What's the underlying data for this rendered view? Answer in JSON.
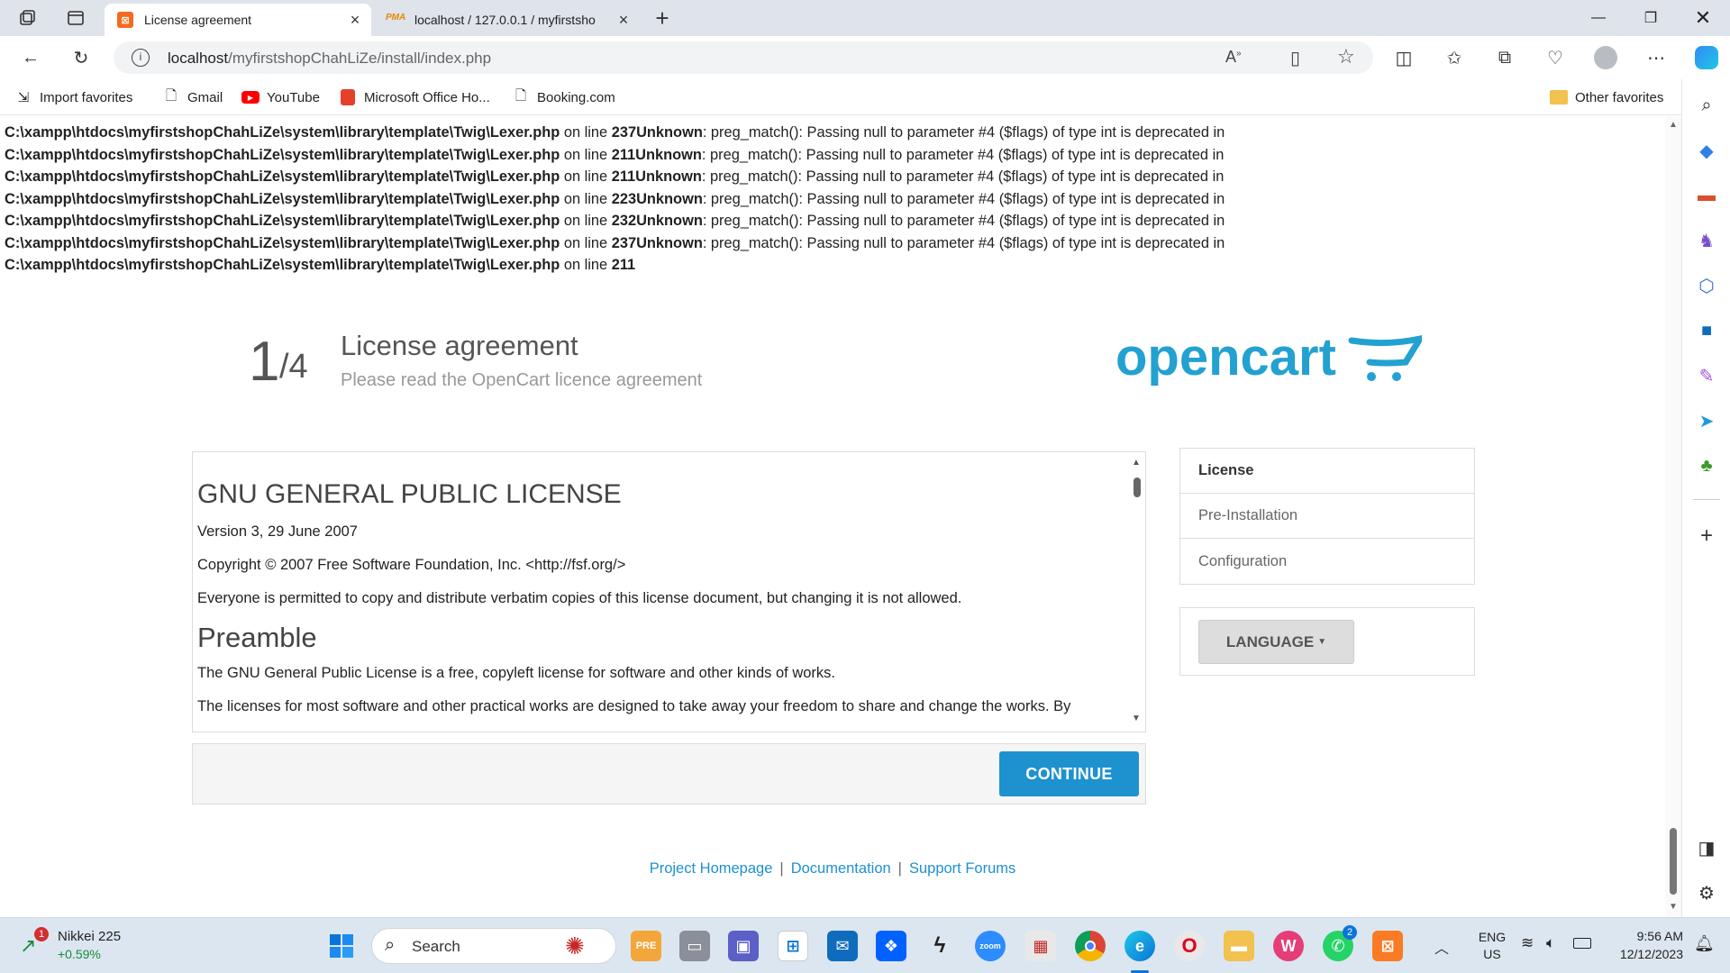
{
  "browser": {
    "tabs": [
      {
        "title": "License agreement",
        "active": true
      },
      {
        "title": "localhost / 127.0.0.1 / myfirstsho",
        "active": false
      }
    ],
    "address": {
      "host": "localhost",
      "path": "/myfirstshopChahLiZe/install/index.php"
    },
    "favorites": [
      "Import favorites",
      "Gmail",
      "YouTube",
      "Microsoft Office Ho...",
      "Booking.com"
    ],
    "other_favorites": "Other favorites"
  },
  "errors": [
    {
      "path": "C:\\xampp\\htdocs\\myfirstshopChahLiZe\\system\\library\\template\\Twig\\Lexer.php",
      "mid": " on line ",
      "line": "237",
      "type": "Unknown",
      "msg": ": preg_match(): Passing null to parameter #4 ($flags) of type int is deprecated in"
    },
    {
      "path": "C:\\xampp\\htdocs\\myfirstshopChahLiZe\\system\\library\\template\\Twig\\Lexer.php",
      "mid": " on line ",
      "line": "211",
      "type": "Unknown",
      "msg": ": preg_match(): Passing null to parameter #4 ($flags) of type int is deprecated in"
    },
    {
      "path": "C:\\xampp\\htdocs\\myfirstshopChahLiZe\\system\\library\\template\\Twig\\Lexer.php",
      "mid": " on line ",
      "line": "211",
      "type": "Unknown",
      "msg": ": preg_match(): Passing null to parameter #4 ($flags) of type int is deprecated in"
    },
    {
      "path": "C:\\xampp\\htdocs\\myfirstshopChahLiZe\\system\\library\\template\\Twig\\Lexer.php",
      "mid": " on line ",
      "line": "223",
      "type": "Unknown",
      "msg": ": preg_match(): Passing null to parameter #4 ($flags) of type int is deprecated in"
    },
    {
      "path": "C:\\xampp\\htdocs\\myfirstshopChahLiZe\\system\\library\\template\\Twig\\Lexer.php",
      "mid": " on line ",
      "line": "232",
      "type": "Unknown",
      "msg": ": preg_match(): Passing null to parameter #4 ($flags) of type int is deprecated in"
    },
    {
      "path": "C:\\xampp\\htdocs\\myfirstshopChahLiZe\\system\\library\\template\\Twig\\Lexer.php",
      "mid": " on line ",
      "line": "237",
      "type": "Unknown",
      "msg": ": preg_match(): Passing null to parameter #4 ($flags) of type int is deprecated in"
    },
    {
      "path": "C:\\xampp\\htdocs\\myfirstshopChahLiZe\\system\\library\\template\\Twig\\Lexer.php",
      "mid": " on line ",
      "line": "211",
      "type": "",
      "msg": ""
    }
  ],
  "installer": {
    "step": "1",
    "total": "/4",
    "title": "License agreement",
    "subtitle": "Please read the OpenCart licence agreement",
    "logo_text": "opencart",
    "license": {
      "heading": "GNU GENERAL PUBLIC LICENSE",
      "version": "Version 3, 29 June 2007",
      "copyright": "Copyright © 2007 Free Software Foundation, Inc. <http://fsf.org/>",
      "permission": "Everyone is permitted to copy and distribute verbatim copies of this license document, but changing it is not allowed.",
      "preamble_heading": "Preamble",
      "p1": "The GNU General Public License is a free, copyleft license for software and other kinds of works.",
      "p2": "The licenses for most software and other practical works are designed to take away your freedom to share and change the works. By"
    },
    "continue_label": "CONTINUE",
    "steps": [
      "License",
      "Pre-Installation",
      "Configuration"
    ],
    "language_label": "LANGUAGE",
    "footer": [
      "Project Homepage",
      "Documentation",
      "Support Forums"
    ]
  },
  "taskbar": {
    "widget_title": "Nikkei 225",
    "widget_value": "+0.59%",
    "widget_badge": "1",
    "search_label": "Search",
    "whatsapp_badge": "2",
    "lang": "ENG",
    "region": "US",
    "time": "9:56 AM",
    "date": "12/12/2023"
  },
  "colors": {
    "accent": "#1e91cf",
    "logo": "#23a1d1"
  }
}
